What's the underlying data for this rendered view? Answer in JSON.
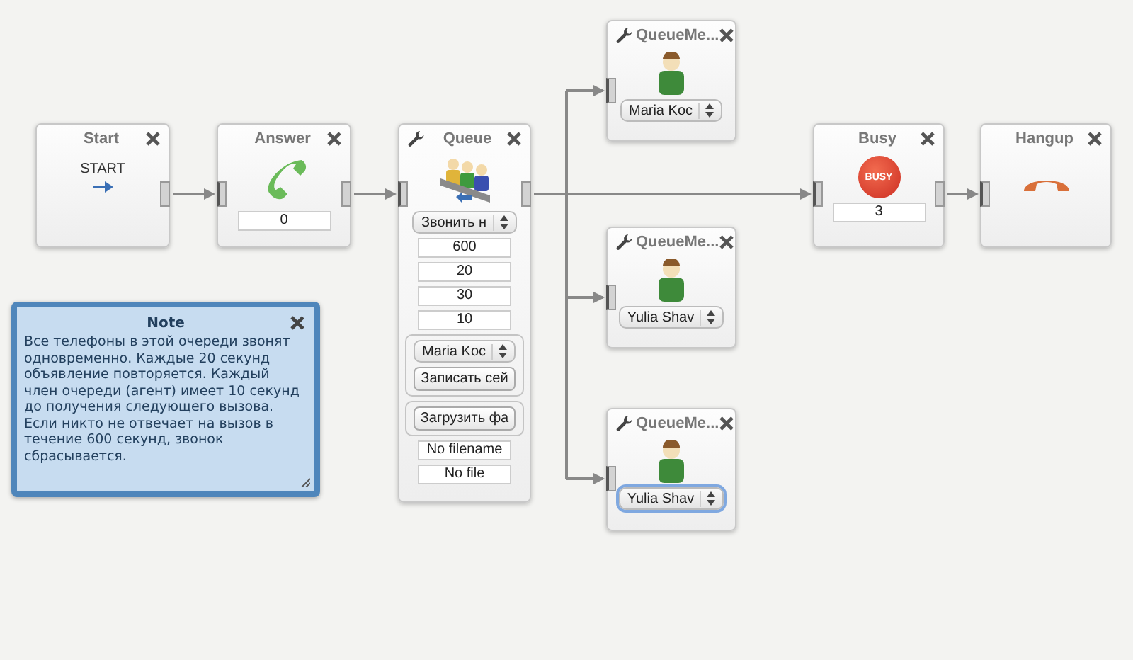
{
  "nodes": [
    {
      "kind": "start",
      "title": "Start",
      "settings": false,
      "label": "START"
    },
    {
      "kind": "answer",
      "title": "Answer",
      "settings": false,
      "fields": [
        {
          "kind": "input",
          "value": "0"
        }
      ]
    },
    {
      "kind": "queue",
      "title": "Queue",
      "settings": true,
      "fields": [
        {
          "kind": "select",
          "value": "Звонить н",
          "focused": false
        },
        {
          "kind": "input",
          "value": "600"
        },
        {
          "kind": "input",
          "value": "20"
        },
        {
          "kind": "input",
          "value": "30"
        },
        {
          "kind": "input",
          "value": "10"
        },
        {
          "kind": "group",
          "fields": [
            {
              "kind": "select",
              "value": "Maria Koc",
              "focused": false
            },
            {
              "kind": "button",
              "value": "Записать сей"
            }
          ]
        },
        {
          "kind": "group",
          "fields": [
            {
              "kind": "button",
              "value": "Загрузить фа"
            }
          ]
        },
        {
          "kind": "input",
          "value": "No filename"
        },
        {
          "kind": "input",
          "value": "No file"
        }
      ]
    },
    {
      "kind": "member",
      "title": "QueueMe...",
      "settings": true,
      "fields": [
        {
          "kind": "select",
          "value": "Maria Koc",
          "focused": false
        }
      ]
    },
    {
      "kind": "member",
      "title": "QueueMe...",
      "settings": true,
      "fields": [
        {
          "kind": "select",
          "value": "Yulia Shav",
          "focused": false
        }
      ]
    },
    {
      "kind": "member",
      "title": "QueueMe...",
      "settings": true,
      "fields": [
        {
          "kind": "select",
          "value": "Yulia Shav",
          "focused": true
        }
      ]
    },
    {
      "kind": "busy",
      "title": "Busy",
      "settings": false,
      "badge": "BUSY",
      "fields": [
        {
          "kind": "input",
          "value": "3"
        }
      ]
    },
    {
      "kind": "hangup",
      "title": "Hangup",
      "settings": false
    }
  ],
  "note": {
    "title": "Note",
    "text": "Все телефоны в этой очереди звонят одновременно. Каждые 20 секунд объявление повторяется. Каждый член очереди (агент) имеет 10 секунд до получения следующего вызова. Если никто не отвечает на вызов в течение 600 секунд, звонок сбрасывается."
  }
}
